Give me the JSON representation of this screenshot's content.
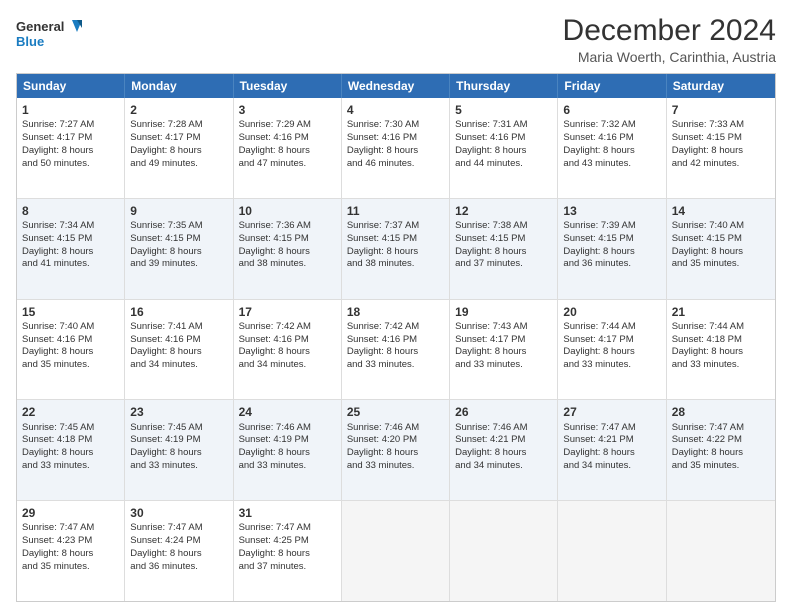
{
  "logo": {
    "line1": "General",
    "line2": "Blue"
  },
  "title": "December 2024",
  "subtitle": "Maria Woerth, Carinthia, Austria",
  "header_days": [
    "Sunday",
    "Monday",
    "Tuesday",
    "Wednesday",
    "Thursday",
    "Friday",
    "Saturday"
  ],
  "rows": [
    [
      {
        "day": "1",
        "lines": [
          "Sunrise: 7:27 AM",
          "Sunset: 4:17 PM",
          "Daylight: 8 hours",
          "and 50 minutes."
        ]
      },
      {
        "day": "2",
        "lines": [
          "Sunrise: 7:28 AM",
          "Sunset: 4:17 PM",
          "Daylight: 8 hours",
          "and 49 minutes."
        ]
      },
      {
        "day": "3",
        "lines": [
          "Sunrise: 7:29 AM",
          "Sunset: 4:16 PM",
          "Daylight: 8 hours",
          "and 47 minutes."
        ]
      },
      {
        "day": "4",
        "lines": [
          "Sunrise: 7:30 AM",
          "Sunset: 4:16 PM",
          "Daylight: 8 hours",
          "and 46 minutes."
        ]
      },
      {
        "day": "5",
        "lines": [
          "Sunrise: 7:31 AM",
          "Sunset: 4:16 PM",
          "Daylight: 8 hours",
          "and 44 minutes."
        ]
      },
      {
        "day": "6",
        "lines": [
          "Sunrise: 7:32 AM",
          "Sunset: 4:16 PM",
          "Daylight: 8 hours",
          "and 43 minutes."
        ]
      },
      {
        "day": "7",
        "lines": [
          "Sunrise: 7:33 AM",
          "Sunset: 4:15 PM",
          "Daylight: 8 hours",
          "and 42 minutes."
        ]
      }
    ],
    [
      {
        "day": "8",
        "lines": [
          "Sunrise: 7:34 AM",
          "Sunset: 4:15 PM",
          "Daylight: 8 hours",
          "and 41 minutes."
        ]
      },
      {
        "day": "9",
        "lines": [
          "Sunrise: 7:35 AM",
          "Sunset: 4:15 PM",
          "Daylight: 8 hours",
          "and 39 minutes."
        ]
      },
      {
        "day": "10",
        "lines": [
          "Sunrise: 7:36 AM",
          "Sunset: 4:15 PM",
          "Daylight: 8 hours",
          "and 38 minutes."
        ]
      },
      {
        "day": "11",
        "lines": [
          "Sunrise: 7:37 AM",
          "Sunset: 4:15 PM",
          "Daylight: 8 hours",
          "and 38 minutes."
        ]
      },
      {
        "day": "12",
        "lines": [
          "Sunrise: 7:38 AM",
          "Sunset: 4:15 PM",
          "Daylight: 8 hours",
          "and 37 minutes."
        ]
      },
      {
        "day": "13",
        "lines": [
          "Sunrise: 7:39 AM",
          "Sunset: 4:15 PM",
          "Daylight: 8 hours",
          "and 36 minutes."
        ]
      },
      {
        "day": "14",
        "lines": [
          "Sunrise: 7:40 AM",
          "Sunset: 4:15 PM",
          "Daylight: 8 hours",
          "and 35 minutes."
        ]
      }
    ],
    [
      {
        "day": "15",
        "lines": [
          "Sunrise: 7:40 AM",
          "Sunset: 4:16 PM",
          "Daylight: 8 hours",
          "and 35 minutes."
        ]
      },
      {
        "day": "16",
        "lines": [
          "Sunrise: 7:41 AM",
          "Sunset: 4:16 PM",
          "Daylight: 8 hours",
          "and 34 minutes."
        ]
      },
      {
        "day": "17",
        "lines": [
          "Sunrise: 7:42 AM",
          "Sunset: 4:16 PM",
          "Daylight: 8 hours",
          "and 34 minutes."
        ]
      },
      {
        "day": "18",
        "lines": [
          "Sunrise: 7:42 AM",
          "Sunset: 4:16 PM",
          "Daylight: 8 hours",
          "and 33 minutes."
        ]
      },
      {
        "day": "19",
        "lines": [
          "Sunrise: 7:43 AM",
          "Sunset: 4:17 PM",
          "Daylight: 8 hours",
          "and 33 minutes."
        ]
      },
      {
        "day": "20",
        "lines": [
          "Sunrise: 7:44 AM",
          "Sunset: 4:17 PM",
          "Daylight: 8 hours",
          "and 33 minutes."
        ]
      },
      {
        "day": "21",
        "lines": [
          "Sunrise: 7:44 AM",
          "Sunset: 4:18 PM",
          "Daylight: 8 hours",
          "and 33 minutes."
        ]
      }
    ],
    [
      {
        "day": "22",
        "lines": [
          "Sunrise: 7:45 AM",
          "Sunset: 4:18 PM",
          "Daylight: 8 hours",
          "and 33 minutes."
        ]
      },
      {
        "day": "23",
        "lines": [
          "Sunrise: 7:45 AM",
          "Sunset: 4:19 PM",
          "Daylight: 8 hours",
          "and 33 minutes."
        ]
      },
      {
        "day": "24",
        "lines": [
          "Sunrise: 7:46 AM",
          "Sunset: 4:19 PM",
          "Daylight: 8 hours",
          "and 33 minutes."
        ]
      },
      {
        "day": "25",
        "lines": [
          "Sunrise: 7:46 AM",
          "Sunset: 4:20 PM",
          "Daylight: 8 hours",
          "and 33 minutes."
        ]
      },
      {
        "day": "26",
        "lines": [
          "Sunrise: 7:46 AM",
          "Sunset: 4:21 PM",
          "Daylight: 8 hours",
          "and 34 minutes."
        ]
      },
      {
        "day": "27",
        "lines": [
          "Sunrise: 7:47 AM",
          "Sunset: 4:21 PM",
          "Daylight: 8 hours",
          "and 34 minutes."
        ]
      },
      {
        "day": "28",
        "lines": [
          "Sunrise: 7:47 AM",
          "Sunset: 4:22 PM",
          "Daylight: 8 hours",
          "and 35 minutes."
        ]
      }
    ],
    [
      {
        "day": "29",
        "lines": [
          "Sunrise: 7:47 AM",
          "Sunset: 4:23 PM",
          "Daylight: 8 hours",
          "and 35 minutes."
        ]
      },
      {
        "day": "30",
        "lines": [
          "Sunrise: 7:47 AM",
          "Sunset: 4:24 PM",
          "Daylight: 8 hours",
          "and 36 minutes."
        ]
      },
      {
        "day": "31",
        "lines": [
          "Sunrise: 7:47 AM",
          "Sunset: 4:25 PM",
          "Daylight: 8 hours",
          "and 37 minutes."
        ]
      },
      {
        "day": "",
        "lines": []
      },
      {
        "day": "",
        "lines": []
      },
      {
        "day": "",
        "lines": []
      },
      {
        "day": "",
        "lines": []
      }
    ]
  ],
  "alt_rows": [
    1,
    3
  ]
}
